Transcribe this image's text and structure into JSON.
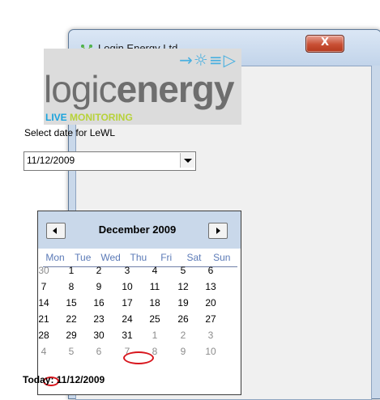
{
  "window": {
    "title": "Login Energy Ltd.",
    "close_label": "X",
    "icon": "app-icon"
  },
  "logo": {
    "text_light": "logic",
    "text_bold": "energy",
    "sub_1": "LIVE",
    "sub_2": "MONITORING",
    "symbol": "→☼≡▷"
  },
  "form": {
    "date_label": "Select date for LeWL",
    "date_value": "11/12/2009"
  },
  "calendar": {
    "month": "December 2009",
    "weekdays": [
      "Mon",
      "Tue",
      "Wed",
      "Thu",
      "Fri",
      "Sat",
      "Sun"
    ],
    "weeks": [
      [
        {
          "d": "30",
          "o": true
        },
        {
          "d": "1"
        },
        {
          "d": "2"
        },
        {
          "d": "3"
        },
        {
          "d": "4"
        },
        {
          "d": "5"
        },
        {
          "d": "6"
        }
      ],
      [
        {
          "d": "7"
        },
        {
          "d": "8"
        },
        {
          "d": "9"
        },
        {
          "d": "10"
        },
        {
          "d": "11"
        },
        {
          "d": "12"
        },
        {
          "d": "13"
        }
      ],
      [
        {
          "d": "14"
        },
        {
          "d": "15"
        },
        {
          "d": "16"
        },
        {
          "d": "17"
        },
        {
          "d": "18"
        },
        {
          "d": "19"
        },
        {
          "d": "20"
        }
      ],
      [
        {
          "d": "21"
        },
        {
          "d": "22"
        },
        {
          "d": "23"
        },
        {
          "d": "24"
        },
        {
          "d": "25"
        },
        {
          "d": "26"
        },
        {
          "d": "27"
        }
      ],
      [
        {
          "d": "28"
        },
        {
          "d": "29"
        },
        {
          "d": "30"
        },
        {
          "d": "31"
        },
        {
          "d": "1",
          "o": true
        },
        {
          "d": "2",
          "o": true
        },
        {
          "d": "3",
          "o": true
        }
      ],
      [
        {
          "d": "4",
          "o": true
        },
        {
          "d": "5",
          "o": true
        },
        {
          "d": "6",
          "o": true
        },
        {
          "d": "7",
          "o": true
        },
        {
          "d": "8",
          "o": true
        },
        {
          "d": "9",
          "o": true
        },
        {
          "d": "10",
          "o": true
        }
      ]
    ],
    "selected_day": "11",
    "today_label": "Today: 11/12/2009"
  },
  "colors": {
    "accent": "#5b7ab7",
    "today_ring": "#d8161d",
    "header_bg": "#c9d8ea"
  }
}
